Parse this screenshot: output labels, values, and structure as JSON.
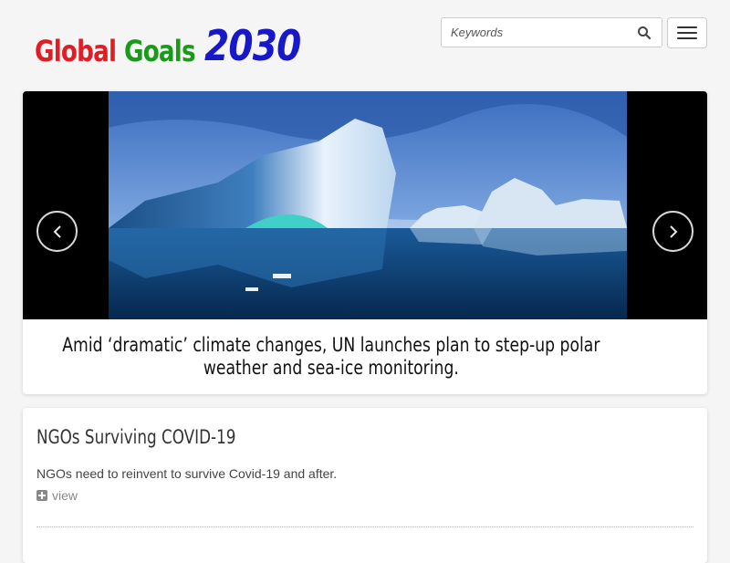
{
  "header": {
    "logo": {
      "global": "Global",
      "goals": "Goals",
      "year": "2030"
    },
    "search": {
      "placeholder": "Keywords",
      "value": ""
    }
  },
  "carousel": {
    "caption": "Amid ‘dramatic’ climate changes, UN launches plan to step-up polar weather and sea-ice monitoring."
  },
  "articles": [
    {
      "title": "NGOs Surviving COVID-19",
      "summary": "NGOs need to reinvent to survive Covid-19 and after.",
      "link_label": "view"
    }
  ],
  "colors": {
    "logo_red": "#e01d24",
    "logo_green": "#1a9a1a",
    "logo_blue": "#1818c8"
  }
}
